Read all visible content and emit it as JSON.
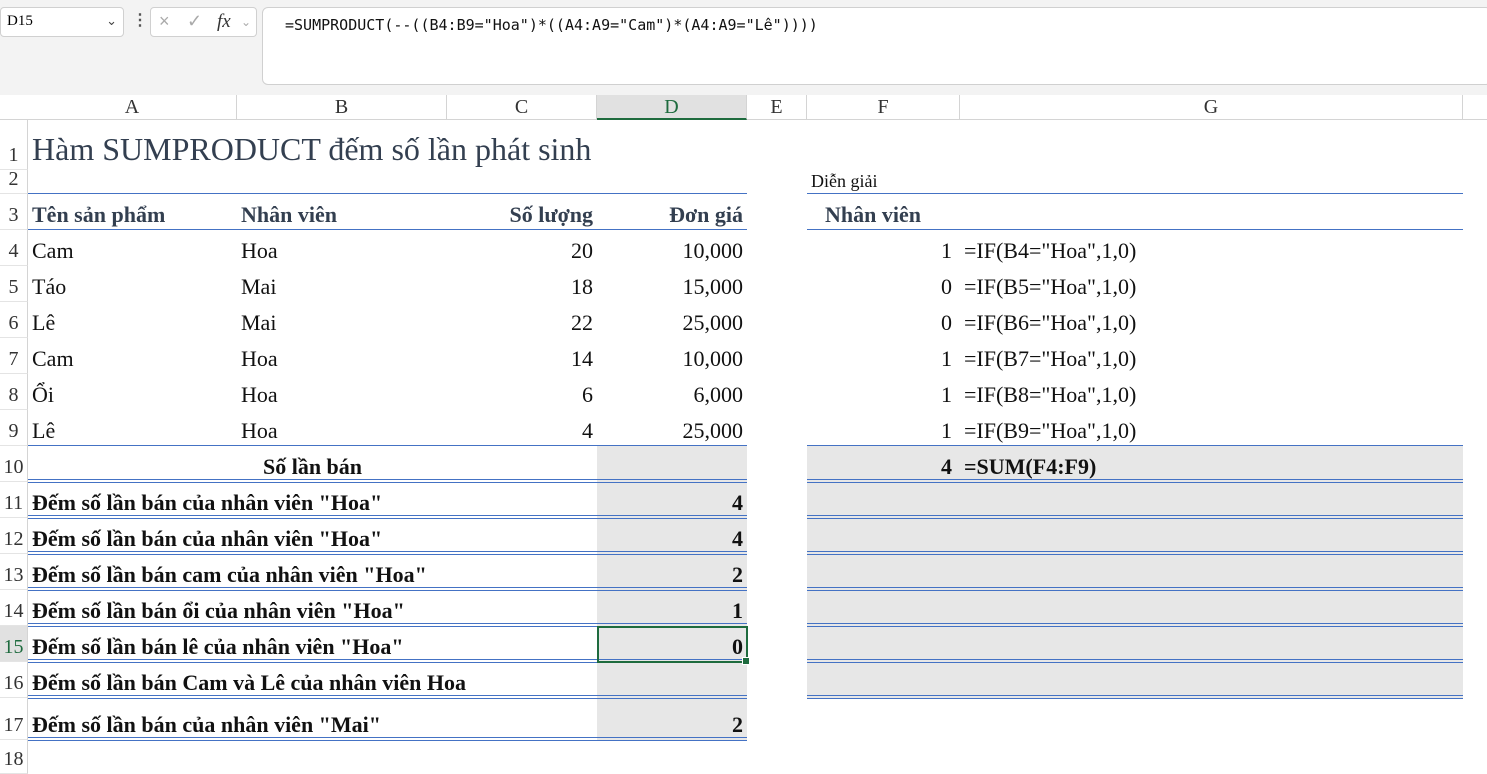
{
  "formula_bar": {
    "name_box": "D15",
    "cancel_icon": "×",
    "enter_icon": "✓",
    "fx_label": "fx",
    "formula": "=SUMPRODUCT(--((B4:B9=\"Hoa\")*((A4:A9=\"Cam\")*(A4:A9=\"Lê\"))))"
  },
  "columns": [
    "A",
    "B",
    "C",
    "D",
    "E",
    "F",
    "G"
  ],
  "selected_cell": "D15",
  "rows": {
    "1": {
      "A": "Hàm SUMPRODUCT đếm số lần phát sinh"
    },
    "2": {
      "F": "Diễn giải"
    },
    "3": {
      "A": "Tên sản phẩm",
      "B": "Nhân viên",
      "C": "Số lượng",
      "D": "Đơn giá",
      "F": "Nhân viên"
    },
    "4": {
      "A": "Cam",
      "B": "Hoa",
      "C": "20",
      "D": "10,000",
      "F": "1",
      "G": "=IF(B4=\"Hoa\",1,0)"
    },
    "5": {
      "A": "Táo",
      "B": "Mai",
      "C": "18",
      "D": "15,000",
      "F": "0",
      "G": "=IF(B5=\"Hoa\",1,0)"
    },
    "6": {
      "A": "Lê",
      "B": "Mai",
      "C": "22",
      "D": "25,000",
      "F": "0",
      "G": "=IF(B6=\"Hoa\",1,0)"
    },
    "7": {
      "A": "Cam",
      "B": "Hoa",
      "C": "14",
      "D": "10,000",
      "F": "1",
      "G": "=IF(B7=\"Hoa\",1,0)"
    },
    "8": {
      "A": "Ổi",
      "B": "Hoa",
      "C": "6",
      "D": "6,000",
      "F": "1",
      "G": "=IF(B8=\"Hoa\",1,0)"
    },
    "9": {
      "A": "Lê",
      "B": "Hoa",
      "C": "4",
      "D": "25,000",
      "F": "1",
      "G": "=IF(B9=\"Hoa\",1,0)"
    },
    "10": {
      "A": "Số lần bán",
      "F": "4",
      "G": "=SUM(F4:F9)"
    },
    "11": {
      "A": "Đếm số lần bán của nhân viên \"Hoa\"",
      "D": "4"
    },
    "12": {
      "A": "Đếm số lần bán của nhân viên \"Hoa\"",
      "D": "4"
    },
    "13": {
      "A": "Đếm số lần bán cam của nhân viên \"Hoa\"",
      "D": "2"
    },
    "14": {
      "A": "Đếm số lần bán ổi của nhân viên \"Hoa\"",
      "D": "1"
    },
    "15": {
      "A": "Đếm số lần bán lê của nhân viên \"Hoa\"",
      "D": "0"
    },
    "16": {
      "A": "Đếm số lần bán Cam và Lê của nhân viên Hoa"
    },
    "17": {
      "A": "Đếm số lần bán của nhân viên \"Mai\"",
      "D": "2"
    },
    "18": {}
  },
  "colors": {
    "accent_border": "#4472c4",
    "selection": "#1e6b3e",
    "fill_gray": "#e7e7e7"
  }
}
